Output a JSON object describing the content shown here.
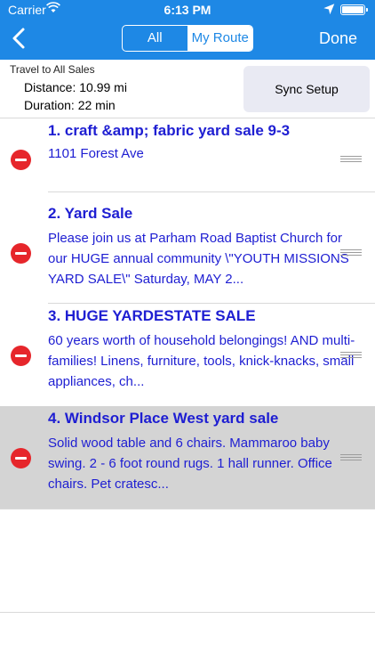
{
  "status_bar": {
    "carrier": "Carrier",
    "time": "6:13 PM"
  },
  "nav": {
    "segments": [
      "All",
      "My Route"
    ],
    "selected": "My Route",
    "done_label": "Done"
  },
  "summary": {
    "title": "Travel to All Sales",
    "distance": "Distance: 10.99 mi",
    "duration": "Duration: 22 min",
    "sync_label": "Sync Setup"
  },
  "sales": [
    {
      "title": "1. craft &amp; fabric yard sale 9-3",
      "description": "1101 Forest Ave"
    },
    {
      "title": "2. Yard Sale",
      "description": "Please join us at Parham Road Baptist Church for our HUGE annual community \\\"YOUTH MISSIONS YARD SALE\\\"  Saturday, MAY 2..."
    },
    {
      "title": "3. HUGE YARDESTATE SALE",
      "description": "60 years worth of household belongings! AND multi-families! Linens, furniture, tools, knick-knacks, small appliances, ch..."
    },
    {
      "title": "4. Windsor Place West yard sale",
      "description": "Solid wood table and 6 chairs.  Mammaroo baby swing.  2 - 6 foot round rugs. 1 hall runner.  Office chairs.  Pet cratesc..."
    }
  ],
  "colors": {
    "nav_bar": "#1e88e5",
    "link_text": "#1e1ed2",
    "delete_button": "#e6262b",
    "selected_row": "#d4d4d4"
  }
}
